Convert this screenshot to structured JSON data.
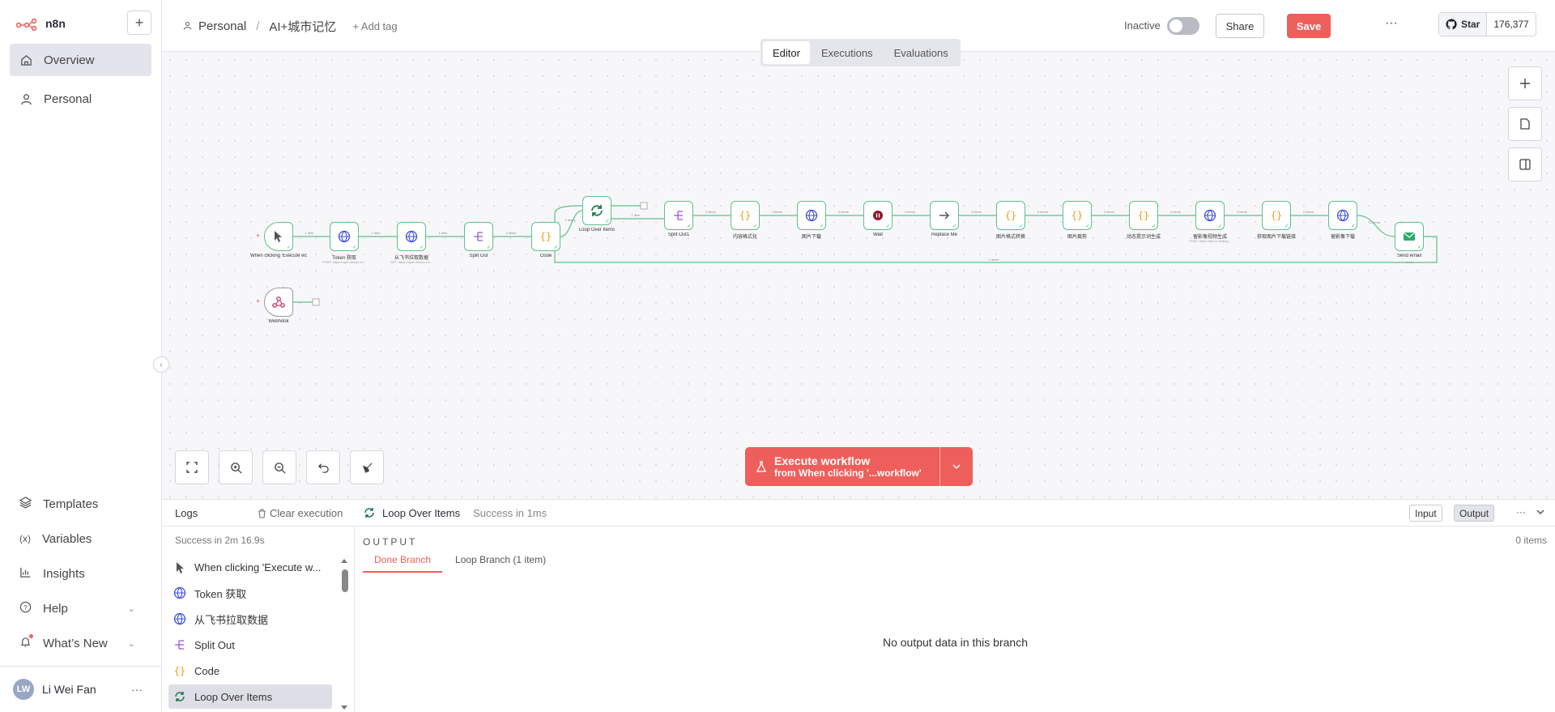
{
  "colors": {
    "accent": "#ee5f5b",
    "node_border": "#5ec08a",
    "sidebar_active": "#e4e5ec"
  },
  "app": {
    "name": "n8n"
  },
  "sidebar": {
    "items": [
      {
        "label": "Overview",
        "icon": "home-icon"
      },
      {
        "label": "Personal",
        "icon": "user-icon"
      }
    ],
    "bottom": [
      {
        "label": "Templates",
        "icon": "templates-icon"
      },
      {
        "label": "Variables",
        "icon": "variables-icon"
      },
      {
        "label": "Insights",
        "icon": "insights-icon"
      },
      {
        "label": "Help",
        "icon": "help-icon"
      },
      {
        "label": "What’s New",
        "icon": "bell-icon"
      }
    ],
    "user": {
      "initials": "LW",
      "name": "Li Wei Fan"
    }
  },
  "header": {
    "breadcrumb_project": "Personal",
    "workflow_name": "AI+城市记忆",
    "add_tag": "+ Add tag",
    "inactive_label": "Inactive",
    "share_label": "Share",
    "save_label": "Save",
    "more": "···",
    "star_label": "Star",
    "star_count": "176,377",
    "tabs": [
      "Editor",
      "Executions",
      "Evaluations"
    ]
  },
  "canvas": {
    "nodes": [
      {
        "label": "When clicking 'Execute workflow'",
        "sub": "",
        "icon": "cursor-icon"
      },
      {
        "label": "Token 获取",
        "sub": "POST: https://open.feishu.cn...",
        "icon": "globe-icon"
      },
      {
        "label": "从飞书拉取数据",
        "sub": "GET: https://open.feishu.cn/...",
        "icon": "globe-icon"
      },
      {
        "label": "Split Out",
        "sub": "",
        "icon": "split-icon"
      },
      {
        "label": "Code",
        "sub": "",
        "icon": "code-icon"
      },
      {
        "label": "Loop Over Items",
        "sub": "",
        "icon": "loop-icon"
      },
      {
        "label": "Split Out1",
        "sub": "",
        "icon": "split-icon"
      },
      {
        "label": "内容格式化",
        "sub": "",
        "icon": "code-icon"
      },
      {
        "label": "图片下载",
        "sub": "",
        "icon": "globe-icon"
      },
      {
        "label": "Wait",
        "sub": "",
        "icon": "pause-icon"
      },
      {
        "label": "Replace Me",
        "sub": "",
        "icon": "arrow-icon"
      },
      {
        "label": "图片格式转换",
        "sub": "",
        "icon": "code-icon"
      },
      {
        "label": "图片裁剪",
        "sub": "",
        "icon": "code-icon"
      },
      {
        "label": "动态提示词生成",
        "sub": "",
        "icon": "code-icon"
      },
      {
        "label": "留影像视频生成",
        "sub": "POST: https://ark.cn-beijing...",
        "icon": "globe-icon"
      },
      {
        "label": "获取图片下载链接",
        "sub": "",
        "icon": "code-icon"
      },
      {
        "label": "留影像下载",
        "sub": "",
        "icon": "globe-icon"
      },
      {
        "label": "Send email",
        "sub": "send",
        "icon": "mail-icon"
      },
      {
        "label": "Webhook",
        "sub": "",
        "icon": "webhook-icon"
      }
    ],
    "conn_labels": [
      "1 item",
      "1 item",
      "1 item",
      "2 items",
      "2 items",
      "1 item",
      "2 items",
      "1 items",
      "2 items",
      "2 items",
      "2 items",
      "2 items",
      "2 items",
      "2 items",
      "2 items",
      "2 items",
      "2 items",
      "2 items",
      "1 items"
    ],
    "execute": {
      "title": "Execute workflow",
      "sub": "from When clicking '...workflow'"
    }
  },
  "logs": {
    "title": "Logs",
    "clear": "Clear execution",
    "success": "Success in 2m 16.9s",
    "items": [
      {
        "label": "When clicking 'Execute w...",
        "icon": "cursor-icon"
      },
      {
        "label": "Token 获取",
        "icon": "globe-icon"
      },
      {
        "label": "从飞书拉取数据",
        "icon": "globe-icon"
      },
      {
        "label": "Split Out",
        "icon": "split-icon"
      },
      {
        "label": "Code",
        "icon": "code-icon"
      },
      {
        "label": "Loop Over Items",
        "icon": "loop-icon"
      }
    ],
    "selected_node": "Loop Over Items",
    "selected_status": "Success in 1ms",
    "input_label": "Input",
    "output_label": "Output",
    "output_title": "OUTPUT",
    "items_count": "0 items",
    "branch_tabs": [
      "Done Branch",
      "Loop Branch (1 item)"
    ],
    "no_output": "No output data in this branch"
  }
}
